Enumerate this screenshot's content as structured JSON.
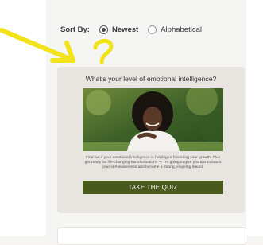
{
  "sort": {
    "label": "Sort By:",
    "options": [
      {
        "label": "Newest",
        "selected": true
      },
      {
        "label": "Alphabetical",
        "selected": false
      }
    ]
  },
  "annotation": {
    "color": "#f2e21a",
    "icons": [
      "arrow-icon",
      "question-mark-icon"
    ]
  },
  "card": {
    "title": "What's your level of emotional intelligence?",
    "image_alt": "Smiling woman with curly hair in a white blouse outdoors among green trees",
    "body": "Find out if your emotional intelligence is helping or hindering your growth! Plus get ready for life-changing transformations — I'm going to give you tips to boost your self-awareness and become a strong, inspiring leader.",
    "button_label": "TAKE THE QUIZ",
    "button_color": "#4a5a1a",
    "background": "#e8e4df"
  }
}
